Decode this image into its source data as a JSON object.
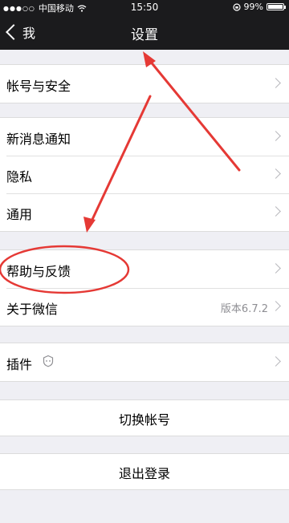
{
  "status_bar": {
    "carrier": "中国移动",
    "time": "15:50",
    "battery": "99%",
    "battery_level": 0.99
  },
  "nav": {
    "back_label": "我",
    "title": "设置"
  },
  "groups": {
    "account": {
      "label": "帐号与安全"
    },
    "notify": {
      "label": "新消息通知"
    },
    "privacy": {
      "label": "隐私"
    },
    "general": {
      "label": "通用"
    },
    "help": {
      "label": "帮助与反馈"
    },
    "about": {
      "label": "关于微信",
      "value": "版本6.7.2"
    },
    "plugins": {
      "label": "插件"
    }
  },
  "actions": {
    "switch_account": "切换帐号",
    "logout": "退出登录"
  },
  "annotation_color": "#e53935"
}
